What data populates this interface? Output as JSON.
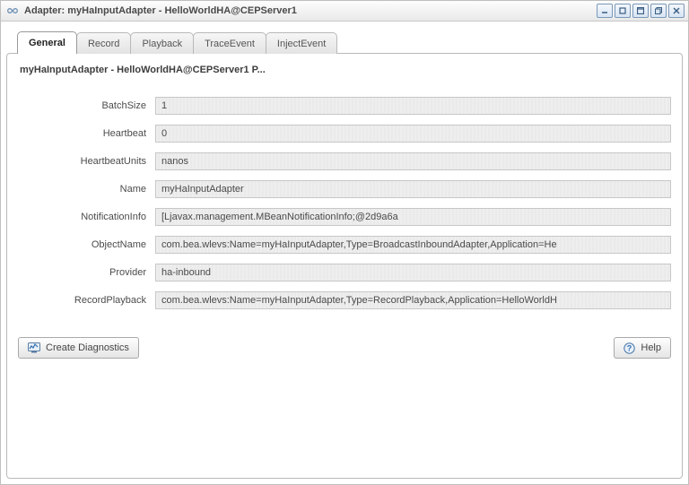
{
  "window": {
    "title": "Adapter: myHaInputAdapter - HelloWorldHA@CEPServer1"
  },
  "tabs": [
    {
      "label": "General"
    },
    {
      "label": "Record"
    },
    {
      "label": "Playback"
    },
    {
      "label": "TraceEvent"
    },
    {
      "label": "InjectEvent"
    }
  ],
  "panel": {
    "heading": "myHaInputAdapter - HelloWorldHA@CEPServer1 P..."
  },
  "fields": {
    "batchSize": {
      "label": "BatchSize",
      "value": "1"
    },
    "heartbeat": {
      "label": "Heartbeat",
      "value": "0"
    },
    "heartbeatUnits": {
      "label": "HeartbeatUnits",
      "value": "nanos"
    },
    "name": {
      "label": "Name",
      "value": "myHaInputAdapter"
    },
    "notificationInfo": {
      "label": "NotificationInfo",
      "value": "[Ljavax.management.MBeanNotificationInfo;@2d9a6a"
    },
    "objectName": {
      "label": "ObjectName",
      "value": "com.bea.wlevs:Name=myHaInputAdapter,Type=BroadcastInboundAdapter,Application=He"
    },
    "provider": {
      "label": "Provider",
      "value": "ha-inbound"
    },
    "recordPlayback": {
      "label": "RecordPlayback",
      "value": "com.bea.wlevs:Name=myHaInputAdapter,Type=RecordPlayback,Application=HelloWorldH"
    }
  },
  "buttons": {
    "createDiagnostics": "Create Diagnostics",
    "help": "Help"
  }
}
